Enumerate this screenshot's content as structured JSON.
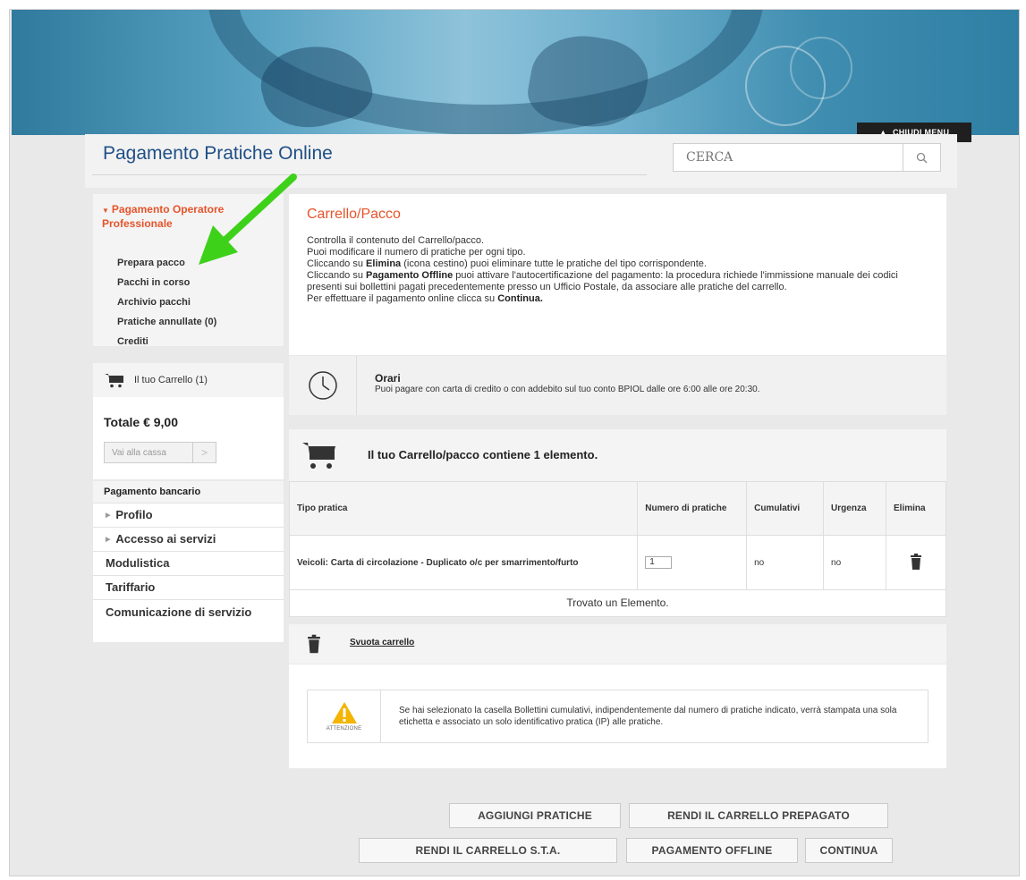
{
  "header": {
    "menu_toggle": "CHIUDI MENU",
    "site_title": "Pagamento Pratiche Online",
    "search_placeholder": "CERCA"
  },
  "sidebar": {
    "section_title": "Pagamento Operatore Professionale",
    "items": [
      {
        "label": "Prepara pacco"
      },
      {
        "label": "Pacchi in corso"
      },
      {
        "label": "Archivio pacchi"
      },
      {
        "label": "Pratiche annullate (0)"
      },
      {
        "label": "Crediti"
      }
    ],
    "cart": {
      "label": "Il tuo Carrello (1)",
      "total": "Totale € 9,00",
      "checkout": "Vai alla cassa"
    },
    "banking": {
      "title": "Pagamento bancario",
      "items": [
        {
          "label": "Profilo"
        },
        {
          "label": "Accesso ai servizi"
        },
        {
          "label": "Modulistica"
        },
        {
          "label": "Tariffario"
        },
        {
          "label": "Comunicazione di servizio"
        }
      ]
    }
  },
  "intro": {
    "title": "Carrello/Pacco",
    "l1": "Controlla il contenuto del Carrello/pacco.",
    "l2": "Puoi modificare il numero di pratiche per ogni tipo.",
    "l3a": "Cliccando su ",
    "l3b": "Elimina",
    "l3c": " (icona cestino) puoi eliminare tutte le pratiche del tipo corrispondente.",
    "l4a": "Cliccando su ",
    "l4b": "Pagamento Offline",
    "l4c": " puoi attivare l'autocertificazione del pagamento: la procedura richiede l'immissione manuale dei codici presenti sui bollettini pagati precedentemente presso un Ufficio Postale, da associare alle pratiche del carrello.",
    "l5a": "Per effettuare il pagamento online clicca su ",
    "l5b": "Continua."
  },
  "hours": {
    "title": "Orari",
    "text": "Puoi pagare con carta di credito o con addebito sul tuo conto BPIOL dalle ore 6:00 alle ore 20:30."
  },
  "cart_summary": "Il tuo Carrello/pacco contiene 1 elemento.",
  "table": {
    "headers": [
      "Tipo pratica",
      "Numero di pratiche",
      "Cumulativi",
      "Urgenza",
      "Elimina"
    ],
    "rows": [
      {
        "tipo": "Veicoli: Carta di circolazione - Duplicato o/c per smarrimento/furto",
        "numero": "1",
        "cumulativi": "no",
        "urgenza": "no"
      }
    ],
    "footer": "Trovato un Elemento."
  },
  "empty_cart": "Svuota carrello",
  "warning": {
    "caption": "ATTENZIONE",
    "text": "Se hai selezionato la casella Bollettini cumulativi, indipendentemente dal numero di pratiche indicato, verrà stampata una sola etichetta e associato un solo identificativo pratica (IP) alle pratiche."
  },
  "buttons": {
    "add": "AGGIUNGI PRATICHE",
    "prepaid": "RENDI IL CARRELLO PREPAGATO",
    "sta": "RENDI IL CARRELLO S.T.A.",
    "offline": "PAGAMENTO OFFLINE",
    "continue": "CONTINUA"
  },
  "colors": {
    "accent": "#e5542b",
    "title_blue": "#1f4f86",
    "annotation_arrow": "#3ed11a"
  }
}
